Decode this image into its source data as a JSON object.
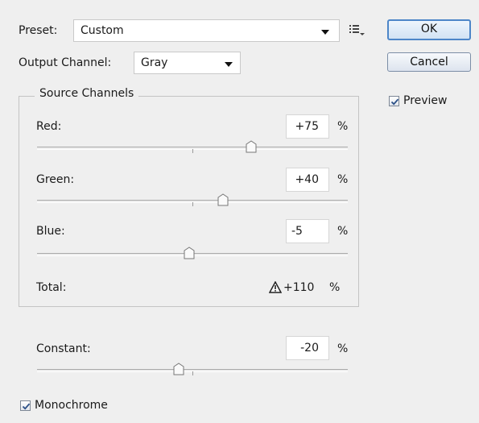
{
  "preset": {
    "label": "Preset:",
    "value": "Custom"
  },
  "output_channel": {
    "label": "Output Channel:",
    "value": "Gray"
  },
  "buttons": {
    "ok": "OK",
    "cancel": "Cancel"
  },
  "preview": {
    "label": "Preview",
    "checked": true
  },
  "source_channels": {
    "title": "Source Channels",
    "channels": [
      {
        "label": "Red:",
        "value": "+75",
        "unit": "%"
      },
      {
        "label": "Green:",
        "value": "+40",
        "unit": "%"
      },
      {
        "label": "Blue:",
        "value": "-5",
        "unit": "%"
      }
    ],
    "total": {
      "label": "Total:",
      "value": "+110",
      "unit": "%",
      "warning_icon": "warning-triangle-icon"
    }
  },
  "constant": {
    "label": "Constant:",
    "value": "-20",
    "unit": "%"
  },
  "monochrome": {
    "label": "Monochrome",
    "checked": true
  },
  "colors": {
    "accent": "#4d86c8",
    "background": "#efefef"
  }
}
